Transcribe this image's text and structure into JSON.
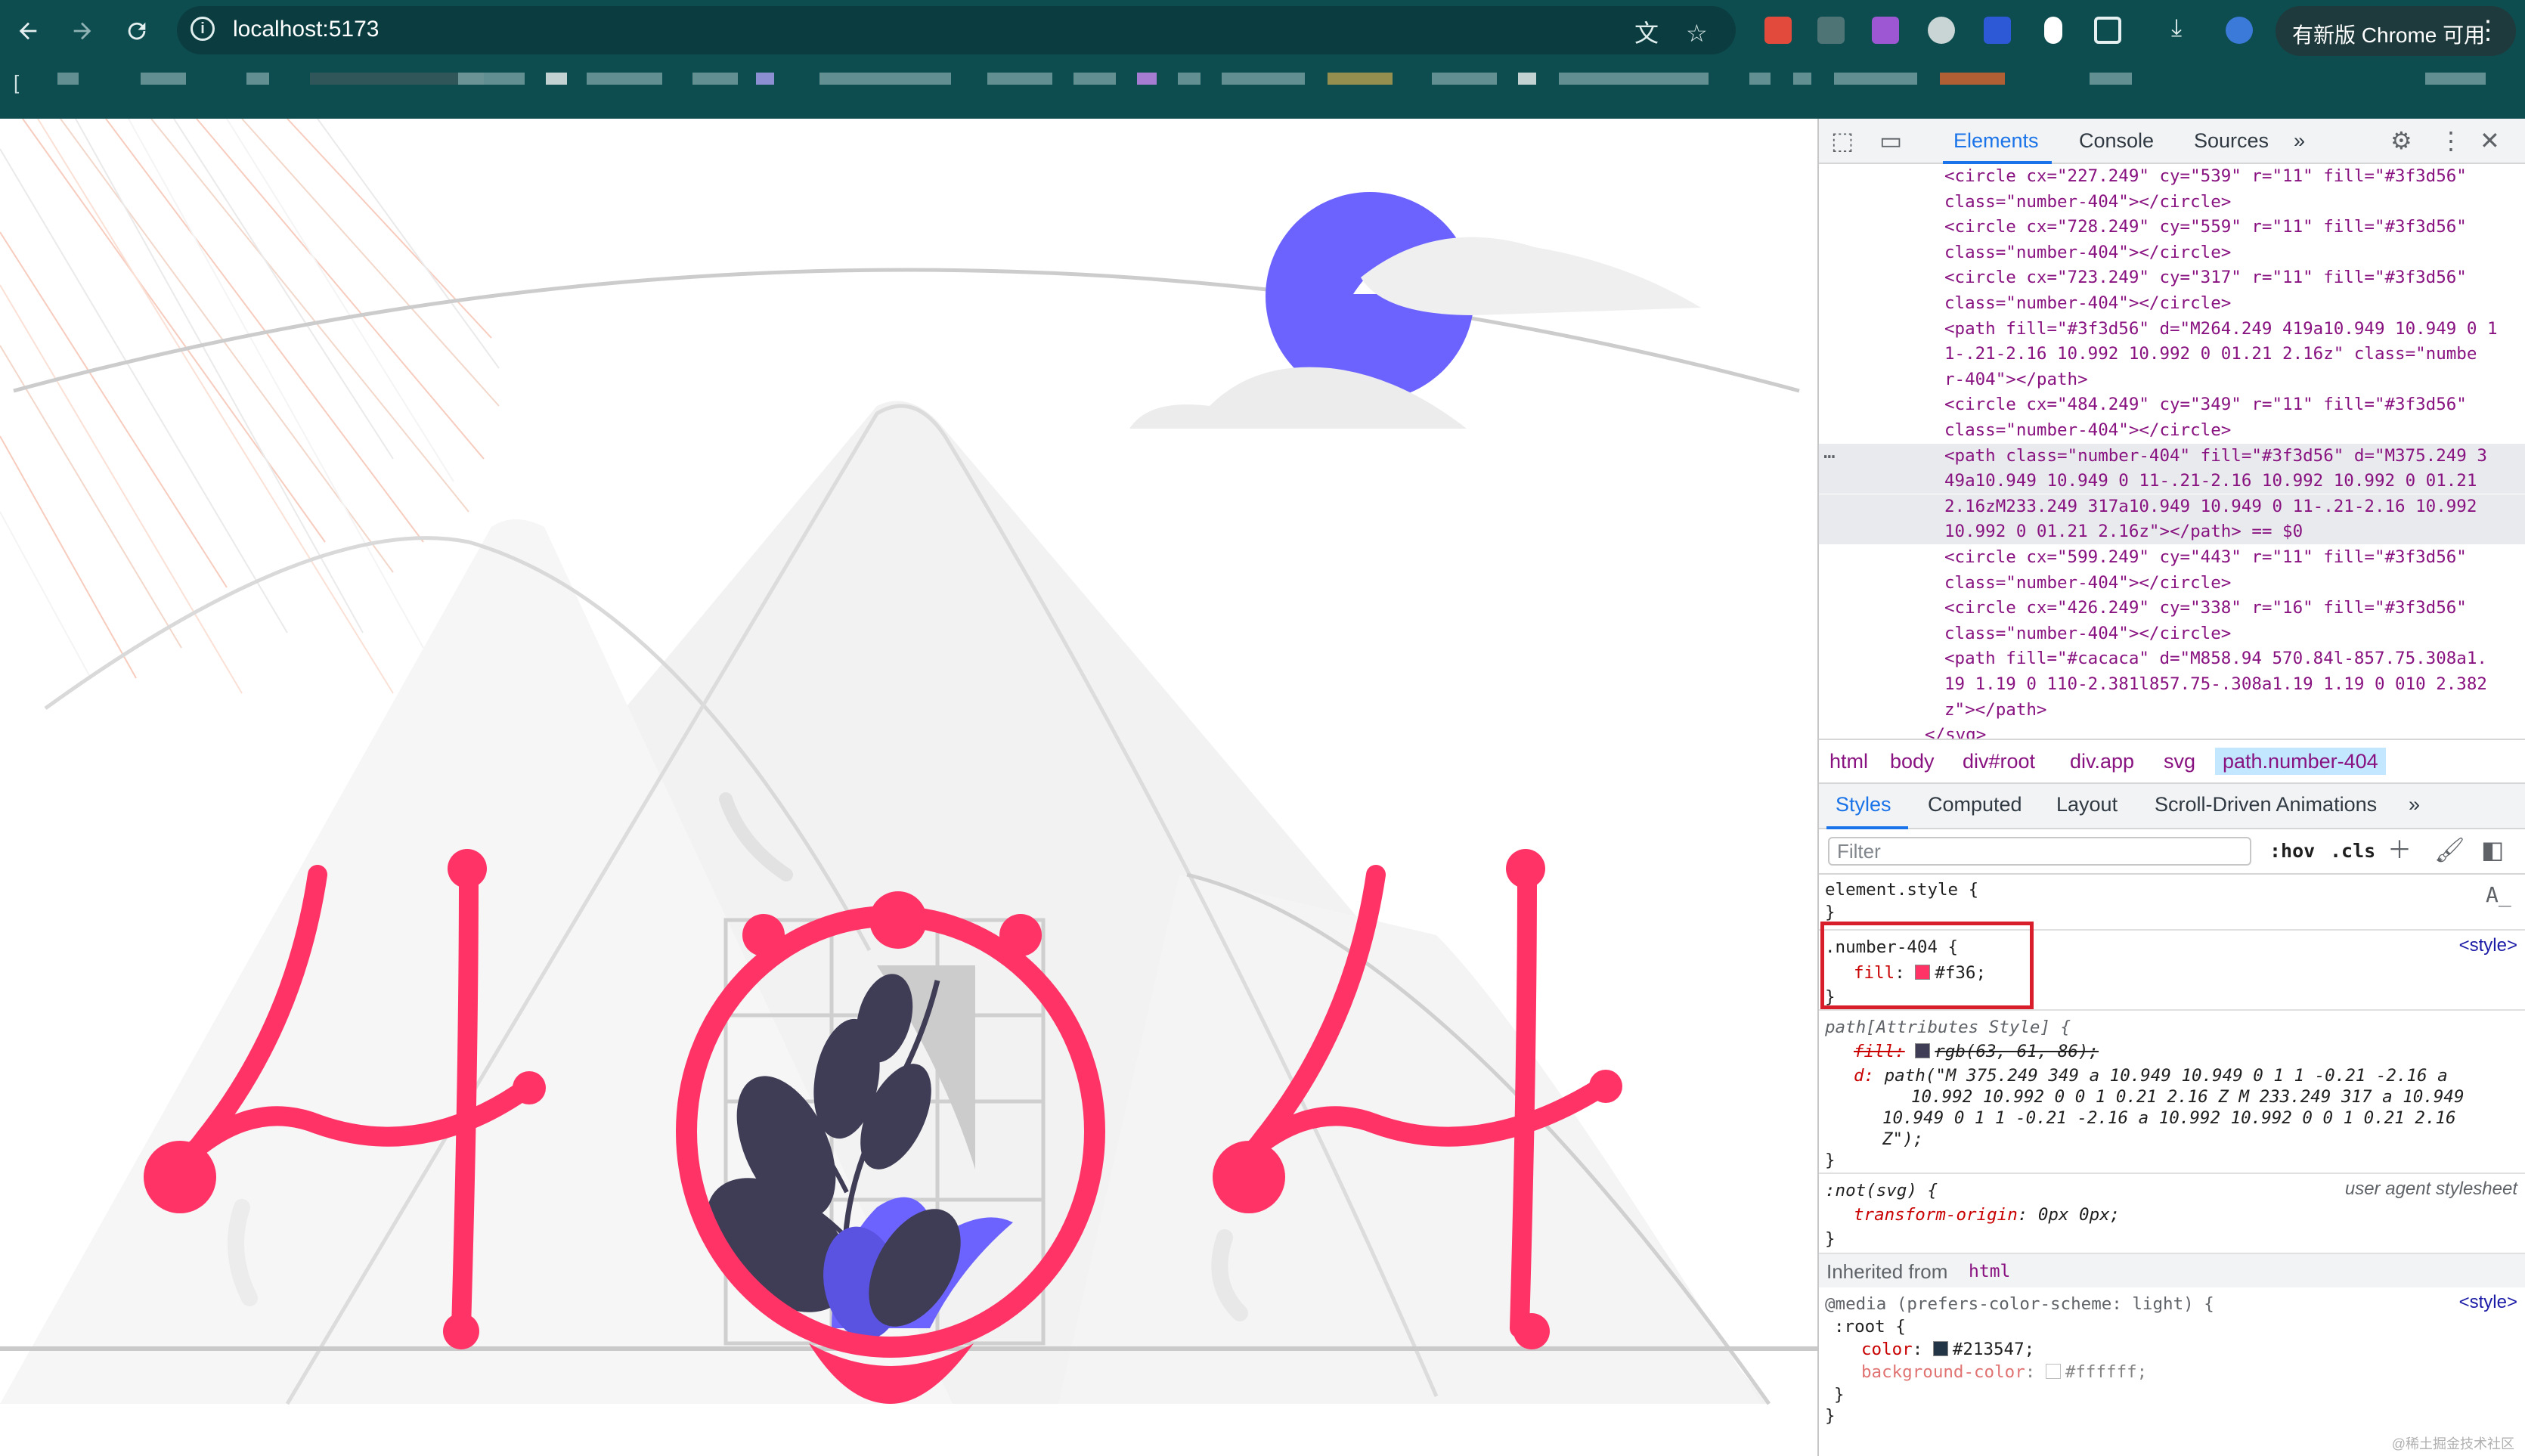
{
  "browser": {
    "url": "localhost:5173",
    "update_label": "有新版 Chrome 可用",
    "menu_glyph": "⋮",
    "left_bookmark_glyph": "["
  },
  "devtools": {
    "tabs": [
      "Elements",
      "Console",
      "Sources"
    ],
    "more_tabs": "»",
    "dom_lines": [
      {
        "text": "<circle cx=\"227.249\" cy=\"539\" r=\"11\" fill=\"#3f3d56\"",
        "selected": false
      },
      {
        "text": "class=\"number-404\"></circle>",
        "selected": false
      },
      {
        "text": "<circle cx=\"728.249\" cy=\"559\" r=\"11\" fill=\"#3f3d56\"",
        "selected": false
      },
      {
        "text": "class=\"number-404\"></circle>",
        "selected": false
      },
      {
        "text": "<circle cx=\"723.249\" cy=\"317\" r=\"11\" fill=\"#3f3d56\"",
        "selected": false
      },
      {
        "text": "class=\"number-404\"></circle>",
        "selected": false
      },
      {
        "text": "<path fill=\"#3f3d56\" d=\"M264.249 419a10.949 10.949 0 1",
        "selected": false
      },
      {
        "text": "1-.21-2.16 10.992 10.992 0 01.21 2.16z\" class=\"numbe",
        "selected": false
      },
      {
        "text": "r-404\"></path>",
        "selected": false
      },
      {
        "text": "<circle cx=\"484.249\" cy=\"349\" r=\"11\" fill=\"#3f3d56\"",
        "selected": false
      },
      {
        "text": "class=\"number-404\"></circle>",
        "selected": false
      },
      {
        "text": "<path class=\"number-404\" fill=\"#3f3d56\" d=\"M375.249 3",
        "selected": true
      },
      {
        "text": "49a10.949 10.949 0 11-.21-2.16 10.992 10.992 0 01.21",
        "selected": true
      },
      {
        "text": "2.16zM233.249 317a10.949 10.949 0 11-.21-2.16 10.992",
        "selected": true
      },
      {
        "text": "10.992 0 01.21 2.16z\"></path> == $0",
        "selected": true
      },
      {
        "text": "<circle cx=\"599.249\" cy=\"443\" r=\"11\" fill=\"#3f3d56\"",
        "selected": false
      },
      {
        "text": "class=\"number-404\"></circle>",
        "selected": false
      },
      {
        "text": "<circle cx=\"426.249\" cy=\"338\" r=\"16\" fill=\"#3f3d56\"",
        "selected": false
      },
      {
        "text": "class=\"number-404\"></circle>",
        "selected": false
      },
      {
        "text": "<path fill=\"#cacaca\" d=\"M858.94 570.84l-857.75.308a1.",
        "selected": false
      },
      {
        "text": "19 1.19 0 110-2.381l857.75-.308a1.19 1.19 0 010 2.382",
        "selected": false
      },
      {
        "text": "z\"></path>",
        "selected": false
      },
      {
        "text": "</svg>",
        "selected": false
      }
    ],
    "dom_ellipsis": "…",
    "breadcrumbs": [
      "html",
      "body",
      "div#root",
      "div.app",
      "svg",
      "path.number-404"
    ],
    "sub_tabs": [
      "Styles",
      "Computed",
      "Layout",
      "Scroll-Driven Animations"
    ],
    "filter_placeholder": "Filter",
    "hov_label": ":hov",
    "cls_label": ".cls",
    "rules": {
      "element_style": {
        "selector": "element.style {",
        "close": "}"
      },
      "number_rule": {
        "selector": ".number-404 {",
        "prop": "fill",
        "value": "#f36;",
        "source": "<style>",
        "close": "}",
        "swatch": "#ff3366"
      },
      "attr_rule": {
        "selector": "path[Attributes Style] {",
        "struck_prop": "fill:",
        "struck_value": "rgb(63, 61, 86);",
        "swatch": "#3f3d56",
        "d_prop": "d:",
        "d_lines": [
          "path(\"M 375.249 349 a 10.949 10.949 0 1 1 -0.21 -2.16 a",
          "10.992 10.992 0 0 1 0.21 2.16 Z M 233.249 317 a 10.949",
          "10.949 0 1 1 -0.21 -2.16 a 10.992 10.992 0 0 1 0.21 2.16",
          "Z\");"
        ],
        "close": "}"
      },
      "ua_rule": {
        "selector": ":not(svg) {",
        "prop": "transform-origin",
        "value": "0px 0px;",
        "source": "user agent stylesheet",
        "close": "}"
      },
      "inherited_label": "Inherited from",
      "inherited_tag": "html",
      "media_rule": {
        "media": "@media (prefers-color-scheme: light) {",
        "selector": ":root {",
        "color_prop": "color",
        "color_value": "#213547;",
        "color_swatch": "#213547",
        "bg_prop": "background-color",
        "bg_value": "#ffffff;",
        "bg_swatch": "#ffffff",
        "source": "<style>",
        "close_inner": "}",
        "close_outer": "}"
      }
    },
    "watermark": "@稀土掘金技术社区"
  },
  "colors": {
    "number_fill": "#ff3366",
    "dark_fill": "#3f3d56",
    "accent": "#6c63ff",
    "mountain": "#f2f2f2",
    "ground": "#cacaca"
  }
}
